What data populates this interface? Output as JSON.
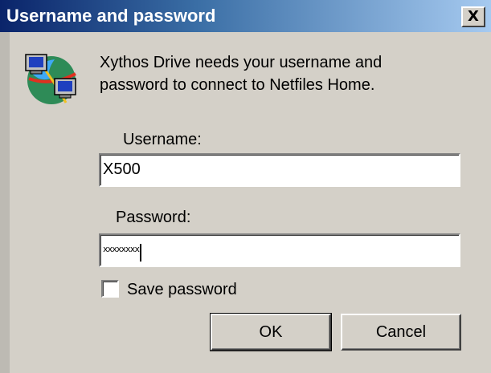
{
  "window": {
    "title": "Username and password",
    "close_glyph": "X",
    "close_icon": "close-icon"
  },
  "message": {
    "line1": "Xythos Drive needs your username and",
    "line2": "password to connect to Netfiles Home.",
    "icon": "network-computers-icon"
  },
  "username": {
    "label": "Username:",
    "value": "X500"
  },
  "password": {
    "label": "Password:",
    "masked_value": "xxxxxxxx"
  },
  "save_password": {
    "label": "Save password",
    "checked": false
  },
  "buttons": {
    "ok": "OK",
    "cancel": "Cancel"
  },
  "colors": {
    "title_gradient_start": "#0a246a",
    "title_gradient_end": "#a6caf0",
    "dialog_face": "#d4d0c8"
  }
}
